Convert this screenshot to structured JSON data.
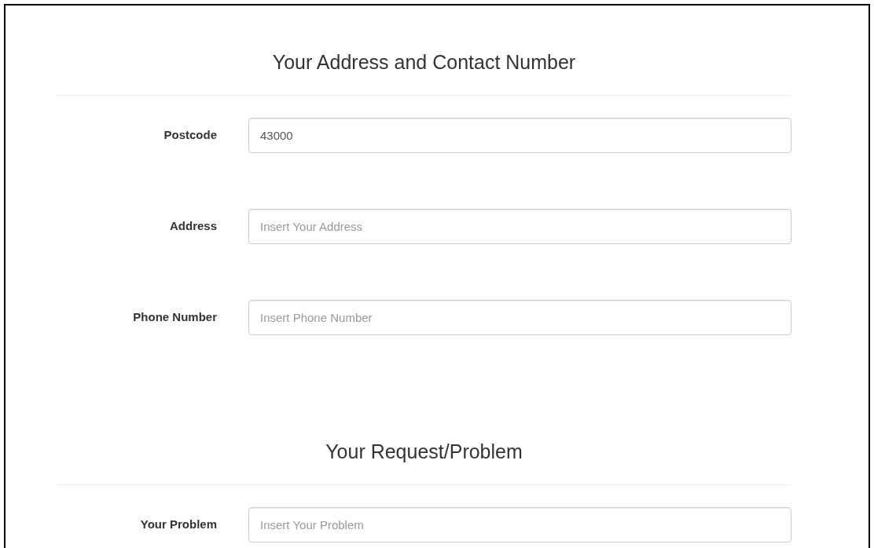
{
  "sections": [
    {
      "title": "Your Address and Contact Number",
      "fields": [
        {
          "label": "Postcode",
          "value": "43000"
        },
        {
          "label": "Address",
          "placeholder": "Insert Your Address"
        },
        {
          "label": "Phone Number",
          "placeholder": "Insert Phone Number"
        }
      ]
    },
    {
      "title": "Your Request/Problem",
      "fields": [
        {
          "label": "Your Problem",
          "placeholder": "Insert Your Problem"
        }
      ]
    }
  ]
}
